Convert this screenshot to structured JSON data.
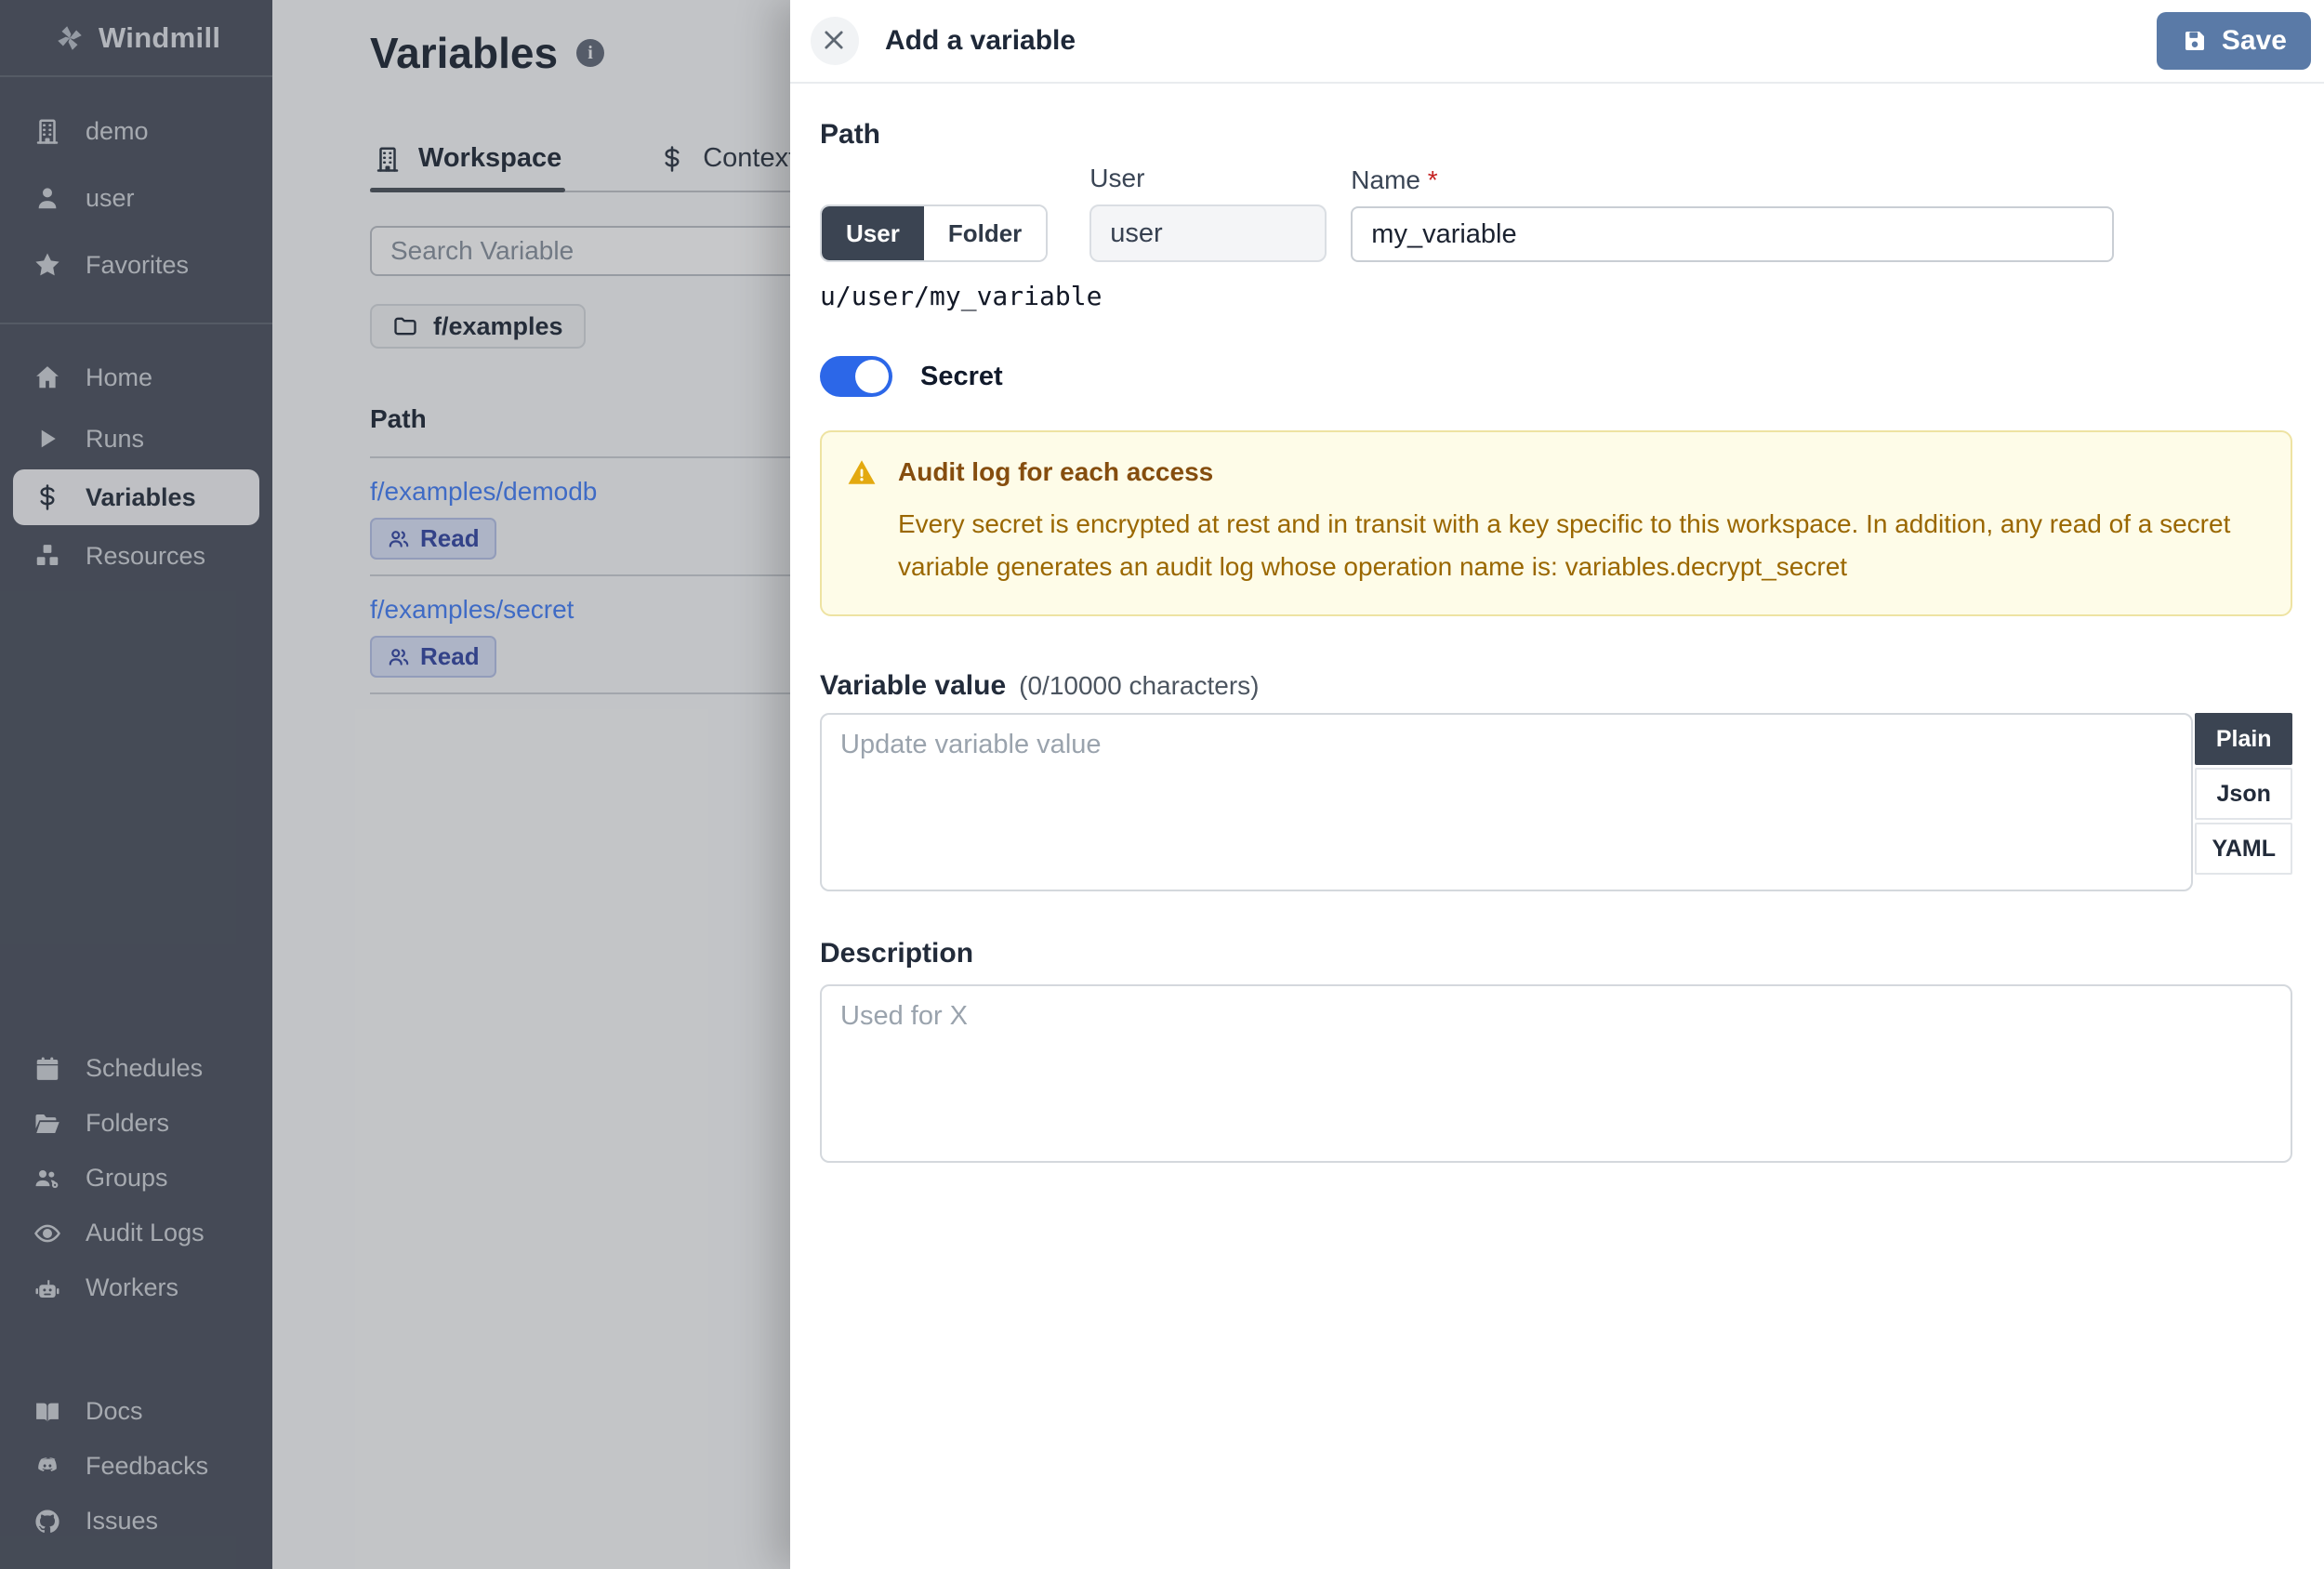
{
  "app": {
    "name": "Windmill"
  },
  "colors": {
    "sidebar_bg": "#565c68",
    "accent_toggle_blue": "#2c67e8",
    "save_button_blue": "#5a7aa7",
    "link_blue": "#4f86f7",
    "warning_bg": "#fefce8",
    "warning_border": "#eee3a2",
    "warning_title": "#854d0e",
    "warning_text": "#9a6700"
  },
  "sidebar": {
    "workspace_label": "demo",
    "user_label": "user",
    "favorites_label": "Favorites",
    "nav": [
      {
        "label": "Home",
        "icon": "home-icon",
        "active": false
      },
      {
        "label": "Runs",
        "icon": "play-icon",
        "active": false
      },
      {
        "label": "Variables",
        "icon": "dollar-icon",
        "active": true
      },
      {
        "label": "Resources",
        "icon": "boxes-icon",
        "active": false
      }
    ],
    "admin": [
      {
        "label": "Schedules",
        "icon": "calendar-icon"
      },
      {
        "label": "Folders",
        "icon": "folder-open-icon"
      },
      {
        "label": "Groups",
        "icon": "users-gear-icon"
      },
      {
        "label": "Audit Logs",
        "icon": "eye-icon"
      },
      {
        "label": "Workers",
        "icon": "robot-icon"
      }
    ],
    "footer": [
      {
        "label": "Docs",
        "icon": "book-open-icon"
      },
      {
        "label": "Feedbacks",
        "icon": "discord-icon"
      },
      {
        "label": "Issues",
        "icon": "github-icon"
      }
    ]
  },
  "main": {
    "title": "Variables",
    "tabs": [
      {
        "label": "Workspace",
        "icon": "building-icon",
        "active": true
      },
      {
        "label": "Context",
        "icon": "dollar-icon",
        "active": false
      }
    ],
    "search_placeholder": "Search Variable",
    "folder_chip": "f/examples",
    "list": {
      "header": "Path",
      "rows": [
        {
          "path": "f/examples/demodb",
          "badge": "Read"
        },
        {
          "path": "f/examples/secret",
          "badge": "Read"
        }
      ]
    }
  },
  "drawer": {
    "title": "Add a variable",
    "save_label": "Save",
    "path_section": {
      "heading": "Path",
      "owner_label": "User",
      "name_label": "Name",
      "required_mark": "*",
      "segmented": {
        "options": [
          "User",
          "Folder"
        ],
        "selected": "User"
      },
      "owner_value": "user",
      "name_value": "my_variable",
      "full_path": "u/user/my_variable"
    },
    "secret_toggle": {
      "label": "Secret",
      "enabled": true
    },
    "warning": {
      "title": "Audit log for each access",
      "body": "Every secret is encrypted at rest and in transit with a key specific to this workspace. In addition, any read of a secret variable generates an audit log whose operation name is: variables.decrypt_secret"
    },
    "value_section": {
      "heading": "Variable value",
      "counter": "(0/10000 characters)",
      "placeholder": "Update variable value",
      "format_tabs": {
        "options": [
          "Plain",
          "Json",
          "YAML"
        ],
        "selected": "Plain"
      }
    },
    "description_section": {
      "heading": "Description",
      "placeholder": "Used for X"
    }
  }
}
